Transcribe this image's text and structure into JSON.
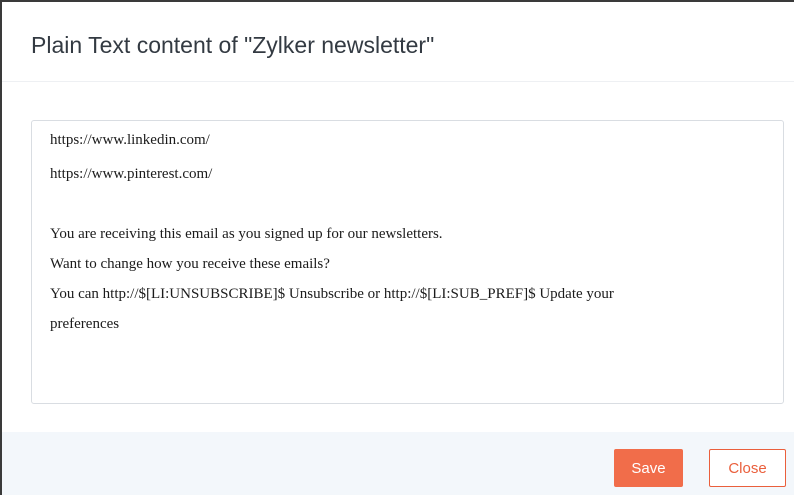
{
  "dialog": {
    "title": "Plain Text content of \"Zylker newsletter\""
  },
  "content": {
    "lines": [
      "https://www.linkedin.com/",
      "https://www.pinterest.com/",
      "",
      "You are receiving this email as you signed up for our newsletters.",
      "Want to change how you receive these emails?",
      "You can http://$[LI:UNSUBSCRIBE]$ Unsubscribe or http://$[LI:SUB_PREF]$ Update your",
      "preferences"
    ]
  },
  "footer": {
    "save_label": "Save",
    "close_label": "Close"
  },
  "colors": {
    "accent": "#f16d4a",
    "footer_bg": "#f3f7fb"
  }
}
